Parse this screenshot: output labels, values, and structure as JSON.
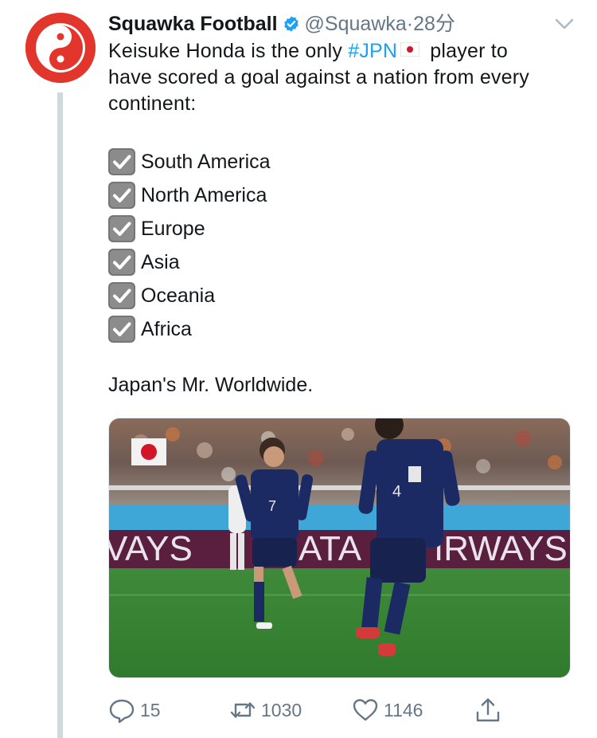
{
  "tweet": {
    "author_name": "Squawka Football",
    "handle": "@Squawka",
    "separator": "·",
    "time": "28分",
    "text_line1_prefix": "Keisuke Honda is the only ",
    "hashtag": "#JPN",
    "text_line1_suffix": " player to",
    "text_line2": "have scored a goal against a nation from every",
    "text_line3": "continent:",
    "checklist": [
      {
        "label": "South America"
      },
      {
        "label": "North America"
      },
      {
        "label": "Europe"
      },
      {
        "label": "Asia"
      },
      {
        "label": "Oceania"
      },
      {
        "label": "Africa"
      }
    ],
    "closing": "Japan's Mr. Worldwide.",
    "photo": {
      "board_left": "VAYS",
      "board_mid": "ATA",
      "board_right": "IRWAYS",
      "jersey_left": "7",
      "jersey_right": "4"
    }
  },
  "actions": {
    "reply_count": "15",
    "retweet_count": "1030",
    "like_count": "1146"
  },
  "icons": {
    "reply": "reply-icon",
    "retweet": "retweet-icon",
    "like": "heart-icon",
    "share": "share-icon",
    "verified": "verified-badge-icon",
    "caret": "chevron-down-icon",
    "checkbox": "checked-box-icon"
  },
  "colors": {
    "accent": "#1da1f2",
    "avatar_bg": "#e2362c",
    "secondary_text": "#657786",
    "flag_red": "#d3152a"
  }
}
